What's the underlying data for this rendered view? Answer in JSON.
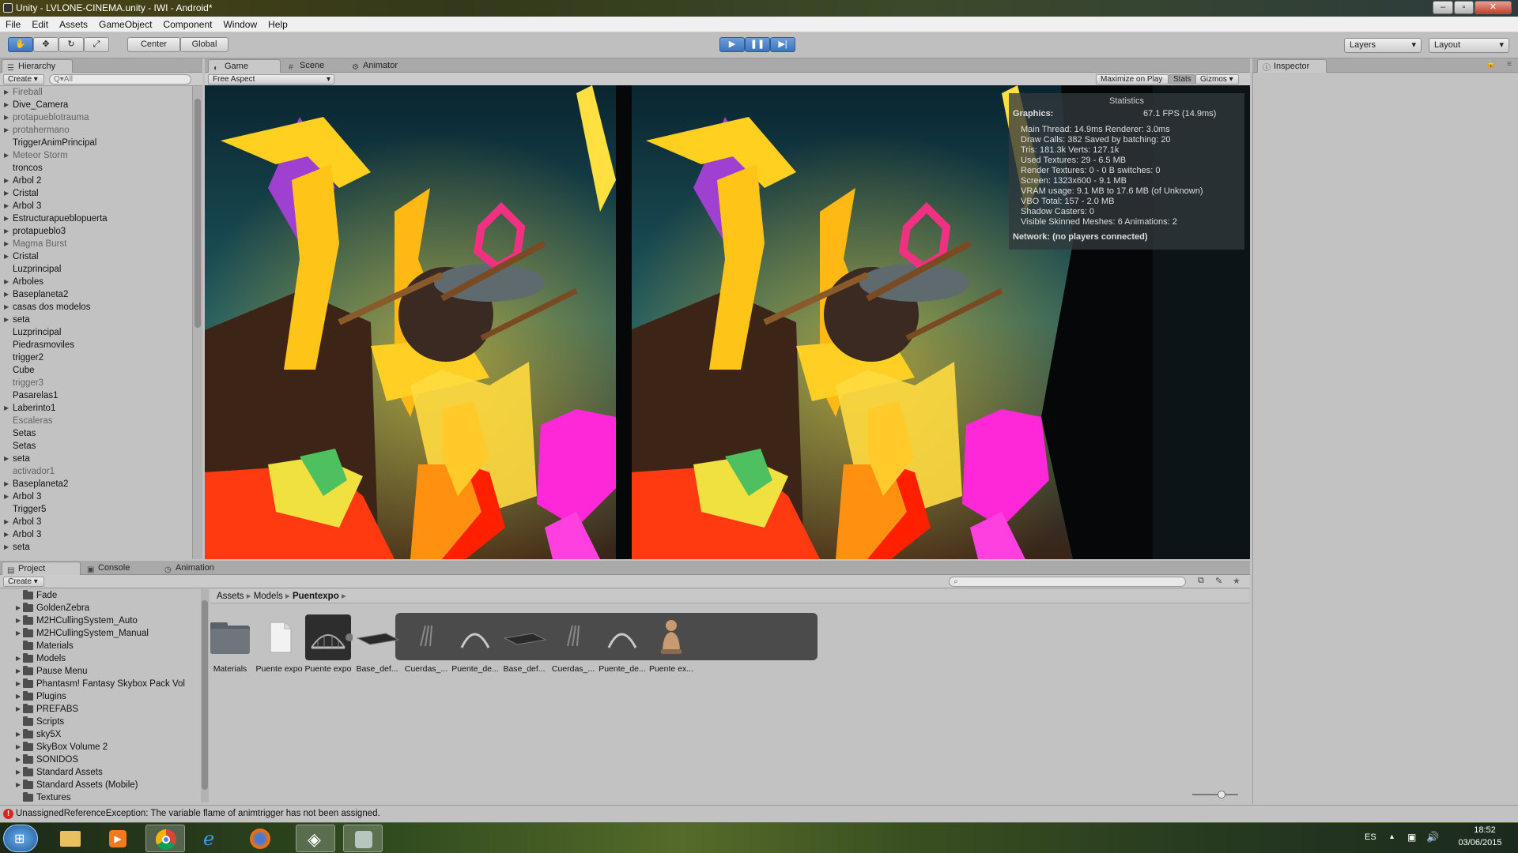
{
  "window": {
    "title": "Unity - LVLONE-CINEMA.unity - IWI - Android*"
  },
  "menu": [
    "File",
    "Edit",
    "Assets",
    "GameObject",
    "Component",
    "Window",
    "Help"
  ],
  "toolbar": {
    "pivot_label": "Center",
    "space_label": "Global",
    "layers_label": "Layers",
    "layout_label": "Layout"
  },
  "hierarchy": {
    "tab": "Hierarchy",
    "create_label": "Create",
    "search_placeholder": "Q▾All",
    "items": [
      {
        "label": "Fireball",
        "expandable": true,
        "dim": true
      },
      {
        "label": "Dive_Camera",
        "expandable": true,
        "dim": false
      },
      {
        "label": "protapueblotrauma",
        "expandable": true,
        "dim": true
      },
      {
        "label": "protahermano",
        "expandable": true,
        "dim": true
      },
      {
        "label": "TriggerAnimPrincipal",
        "expandable": false,
        "dim": false
      },
      {
        "label": "Meteor Storm",
        "expandable": true,
        "dim": true
      },
      {
        "label": "troncos",
        "expandable": false,
        "dim": false
      },
      {
        "label": "Arbol 2",
        "expandable": true,
        "dim": false
      },
      {
        "label": "Cristal",
        "expandable": true,
        "dim": false
      },
      {
        "label": "Arbol 3",
        "expandable": true,
        "dim": false
      },
      {
        "label": "Estructurapueblopuerta",
        "expandable": true,
        "dim": false
      },
      {
        "label": "protapueblo3",
        "expandable": true,
        "dim": false
      },
      {
        "label": "Magma Burst",
        "expandable": true,
        "dim": true
      },
      {
        "label": "Cristal",
        "expandable": true,
        "dim": false
      },
      {
        "label": "Luzprincipal",
        "expandable": false,
        "dim": false
      },
      {
        "label": "Arboles",
        "expandable": true,
        "dim": false
      },
      {
        "label": "Baseplaneta2",
        "expandable": true,
        "dim": false
      },
      {
        "label": "casas dos modelos",
        "expandable": true,
        "dim": false
      },
      {
        "label": "seta",
        "expandable": true,
        "dim": false
      },
      {
        "label": "Luzprincipal",
        "expandable": false,
        "dim": false
      },
      {
        "label": "Piedrasmoviles",
        "expandable": false,
        "dim": false
      },
      {
        "label": "trigger2",
        "expandable": false,
        "dim": false
      },
      {
        "label": "Cube",
        "expandable": false,
        "dim": false
      },
      {
        "label": "trigger3",
        "expandable": false,
        "dim": true
      },
      {
        "label": "Pasarelas1",
        "expandable": false,
        "dim": false
      },
      {
        "label": "Laberinto1",
        "expandable": true,
        "dim": false
      },
      {
        "label": "Escaleras",
        "expandable": false,
        "dim": true
      },
      {
        "label": "Setas",
        "expandable": false,
        "dim": false
      },
      {
        "label": "Setas",
        "expandable": false,
        "dim": false
      },
      {
        "label": "seta",
        "expandable": true,
        "dim": false
      },
      {
        "label": "activador1",
        "expandable": false,
        "dim": true
      },
      {
        "label": "Baseplaneta2",
        "expandable": true,
        "dim": false
      },
      {
        "label": "Arbol 3",
        "expandable": true,
        "dim": false
      },
      {
        "label": "Trigger5",
        "expandable": false,
        "dim": false
      },
      {
        "label": "Arbol 3",
        "expandable": true,
        "dim": false
      },
      {
        "label": "Arbol 3",
        "expandable": true,
        "dim": false
      },
      {
        "label": "seta",
        "expandable": true,
        "dim": false
      }
    ]
  },
  "center_tabs": {
    "game": "Game",
    "scene": "Scene",
    "animator": "Animator"
  },
  "game_bar": {
    "aspect": "Free Aspect",
    "maximize": "Maximize on Play",
    "stats": "Stats",
    "gizmos": "Gizmos"
  },
  "inspector": {
    "tab": "Inspector"
  },
  "statistics": {
    "title": "Statistics",
    "graphics_label": "Graphics:",
    "fps": "67.1 FPS (14.9ms)",
    "lines": [
      "Main Thread: 14.9ms  Renderer: 3.0ms",
      "Draw Calls: 382   Saved by batching: 20",
      "Tris: 181.3k     Verts: 127.1k",
      "Used Textures: 29 - 6.5 MB",
      "Render Textures: 0 - 0 B  switches: 0",
      "Screen: 1323x600 - 9.1 MB",
      "VRAM usage: 9.1 MB to 17.6 MB (of Unknown)",
      "VBO Total: 157 - 2.0 MB",
      "Shadow Casters: 0",
      "Visible Skinned Meshes: 6      Animations: 2"
    ],
    "network": "Network: (no players connected)"
  },
  "bottom_tabs": {
    "project": "Project",
    "console": "Console",
    "animation": "Animation"
  },
  "project": {
    "create_label": "Create",
    "tree": [
      {
        "label": "Fade",
        "arrow": false
      },
      {
        "label": "GoldenZebra",
        "arrow": true
      },
      {
        "label": "M2HCullingSystem_Auto",
        "arrow": true
      },
      {
        "label": "M2HCullingSystem_Manual",
        "arrow": true
      },
      {
        "label": "Materials",
        "arrow": false
      },
      {
        "label": "Models",
        "arrow": true
      },
      {
        "label": "Pause Menu",
        "arrow": true
      },
      {
        "label": "Phantasm! Fantasy Skybox Pack Vol",
        "arrow": true
      },
      {
        "label": "Plugins",
        "arrow": true
      },
      {
        "label": "PREFABS",
        "arrow": true
      },
      {
        "label": "Scripts",
        "arrow": false
      },
      {
        "label": "sky5X",
        "arrow": true
      },
      {
        "label": "SkyBox Volume 2",
        "arrow": true
      },
      {
        "label": "SONIDOS",
        "arrow": true
      },
      {
        "label": "Standard Assets",
        "arrow": true
      },
      {
        "label": "Standard Assets (Mobile)",
        "arrow": true
      },
      {
        "label": "Textures",
        "arrow": false
      }
    ],
    "breadcrumb": {
      "a": "Assets",
      "b": "Models",
      "c": "Puentexpo"
    },
    "assets": [
      {
        "label": "Materials",
        "kind": "folder"
      },
      {
        "label": "Puente expo",
        "kind": "file"
      },
      {
        "label": "Puente expo",
        "kind": "model-selected"
      },
      {
        "label": "Base_def...",
        "kind": "plank"
      },
      {
        "label": "Cuerdas_...",
        "kind": "ropes"
      },
      {
        "label": "Puente_de...",
        "kind": "arch"
      },
      {
        "label": "Base_def...",
        "kind": "plank"
      },
      {
        "label": "Cuerdas_...",
        "kind": "ropes"
      },
      {
        "label": "Puente_de...",
        "kind": "arch"
      },
      {
        "label": "Puente ex...",
        "kind": "avatar"
      }
    ]
  },
  "status": {
    "message": "UnassignedReferenceException: The variable flame of animtrigger has not been assigned."
  },
  "taskbar": {
    "lang": "ES",
    "time": "18:52",
    "date": "03/06/2015"
  },
  "colors": {
    "play_blue": "#3b73be",
    "stats_bg": "#32393c",
    "error_red": "#d9261c"
  }
}
